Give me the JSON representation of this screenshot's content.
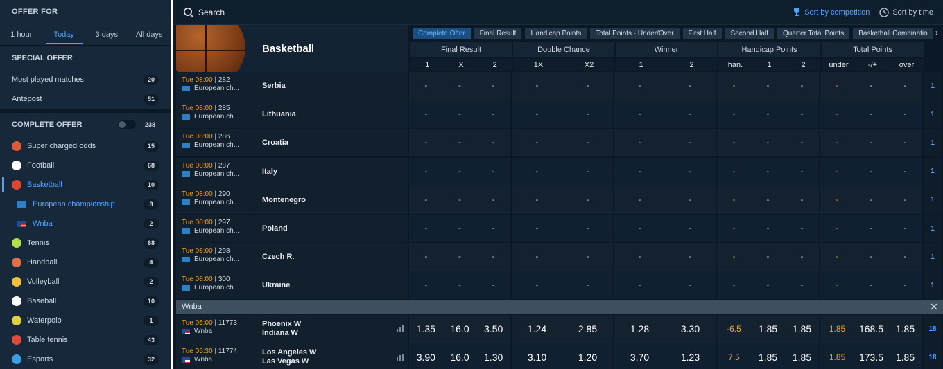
{
  "sidebar": {
    "offer_for": "OFFER FOR",
    "time_tabs": [
      "1 hour",
      "Today",
      "3 days",
      "All days"
    ],
    "active_time_tab": "Today",
    "special_offer": "SPECIAL OFFER",
    "special_items": [
      {
        "label": "Most played matches",
        "count": "20"
      },
      {
        "label": "Antepost",
        "count": "51"
      }
    ],
    "complete_offer": "COMPLETE OFFER",
    "complete_count": "238",
    "sports": [
      {
        "label": "Super charged odds",
        "count": "15",
        "icon": "rocket-icon",
        "color": "#e05a3a"
      },
      {
        "label": "Football",
        "count": "68",
        "icon": "football-icon",
        "color": "#ffffff"
      },
      {
        "label": "Basketball",
        "count": "10",
        "icon": "basketball-icon",
        "color": "#e0452f"
      },
      {
        "label": "European championship",
        "count": "8",
        "icon": "eu-flag-icon",
        "color": "#3a8fd4"
      },
      {
        "label": "Wnba",
        "count": "2",
        "icon": "us-flag-icon",
        "color": "#c23b3b"
      },
      {
        "label": "Tennis",
        "count": "68",
        "icon": "tennis-icon",
        "color": "#b6e04a"
      },
      {
        "label": "Handball",
        "count": "4",
        "icon": "handball-icon",
        "color": "#e0704a"
      },
      {
        "label": "Volleyball",
        "count": "2",
        "icon": "volleyball-icon",
        "color": "#f0c040"
      },
      {
        "label": "Baseball",
        "count": "10",
        "icon": "baseball-icon",
        "color": "#ffffff"
      },
      {
        "label": "Waterpolo",
        "count": "1",
        "icon": "waterpolo-icon",
        "color": "#e0d040"
      },
      {
        "label": "Table tennis",
        "count": "43",
        "icon": "table-tennis-icon",
        "color": "#e04a3a"
      },
      {
        "label": "Esports",
        "count": "32",
        "icon": "esports-icon",
        "color": "#3a9fe0"
      }
    ]
  },
  "topbar": {
    "search_label": "Search",
    "sort_competition": "Sort by competition",
    "sort_time": "Sort by time"
  },
  "hero": {
    "title": "Basketball"
  },
  "market_tabs": [
    "Complete Offer",
    "Final Result",
    "Handicap Points",
    "Total Points - Under/Over",
    "First Half",
    "Second Half",
    "Quarter Total Points",
    "Basketball Combinatio"
  ],
  "active_market_tab": "Complete Offer",
  "columns": {
    "groups": [
      {
        "label": "Final Result",
        "subs": [
          "1",
          "X",
          "2"
        ]
      },
      {
        "label": "Double Chance",
        "subs": [
          "1X",
          "X2"
        ]
      },
      {
        "label": "Winner",
        "subs": [
          "1",
          "2"
        ]
      },
      {
        "label": "Handicap Points",
        "subs": [
          "han.",
          "1",
          "2"
        ]
      },
      {
        "label": "Total Points",
        "subs": [
          "under",
          "-/+",
          "over"
        ]
      }
    ]
  },
  "european_matches": [
    {
      "day_time": "Tue 08:00",
      "code": "282",
      "competition": "European ch...",
      "team": "Serbia",
      "more": "1"
    },
    {
      "day_time": "Tue 08:00",
      "code": "285",
      "competition": "European ch...",
      "team": "Lithuania",
      "more": "1"
    },
    {
      "day_time": "Tue 08:00",
      "code": "286",
      "competition": "European ch...",
      "team": "Croatia",
      "more": "1"
    },
    {
      "day_time": "Tue 08:00",
      "code": "287",
      "competition": "European ch...",
      "team": "Italy",
      "more": "1"
    },
    {
      "day_time": "Tue 08:00",
      "code": "290",
      "competition": "European ch...",
      "team": "Montenegro",
      "more": "1"
    },
    {
      "day_time": "Tue 08:00",
      "code": "297",
      "competition": "European ch...",
      "team": "Poland",
      "more": "1"
    },
    {
      "day_time": "Tue 08:00",
      "code": "298",
      "competition": "European ch...",
      "team": "Czech R.",
      "more": "1"
    },
    {
      "day_time": "Tue 08:00",
      "code": "300",
      "competition": "European ch...",
      "team": "Ukraine",
      "more": "1"
    }
  ],
  "empty_odd": "-",
  "wnba_header": "Wnba",
  "wnba_matches": [
    {
      "day_time": "Tue 05:00",
      "code": "11773",
      "competition": "Wnba",
      "home": "Phoenix W",
      "away": "Indiana W",
      "odds": [
        "1.35",
        "16.0",
        "3.50",
        "1.24",
        "2.85",
        "1.28",
        "3.30",
        "-6.5",
        "1.85",
        "1.85",
        "1.85",
        "168.5",
        "1.85"
      ],
      "more": "18"
    },
    {
      "day_time": "Tue 05:30",
      "code": "11774",
      "competition": "Wnba",
      "home": "Los Angeles W",
      "away": "Las Vegas W",
      "odds": [
        "3.90",
        "16.0",
        "1.30",
        "3.10",
        "1.20",
        "3.70",
        "1.23",
        "7.5",
        "1.85",
        "1.85",
        "1.85",
        "173.5",
        "1.85"
      ],
      "more": "18"
    }
  ]
}
